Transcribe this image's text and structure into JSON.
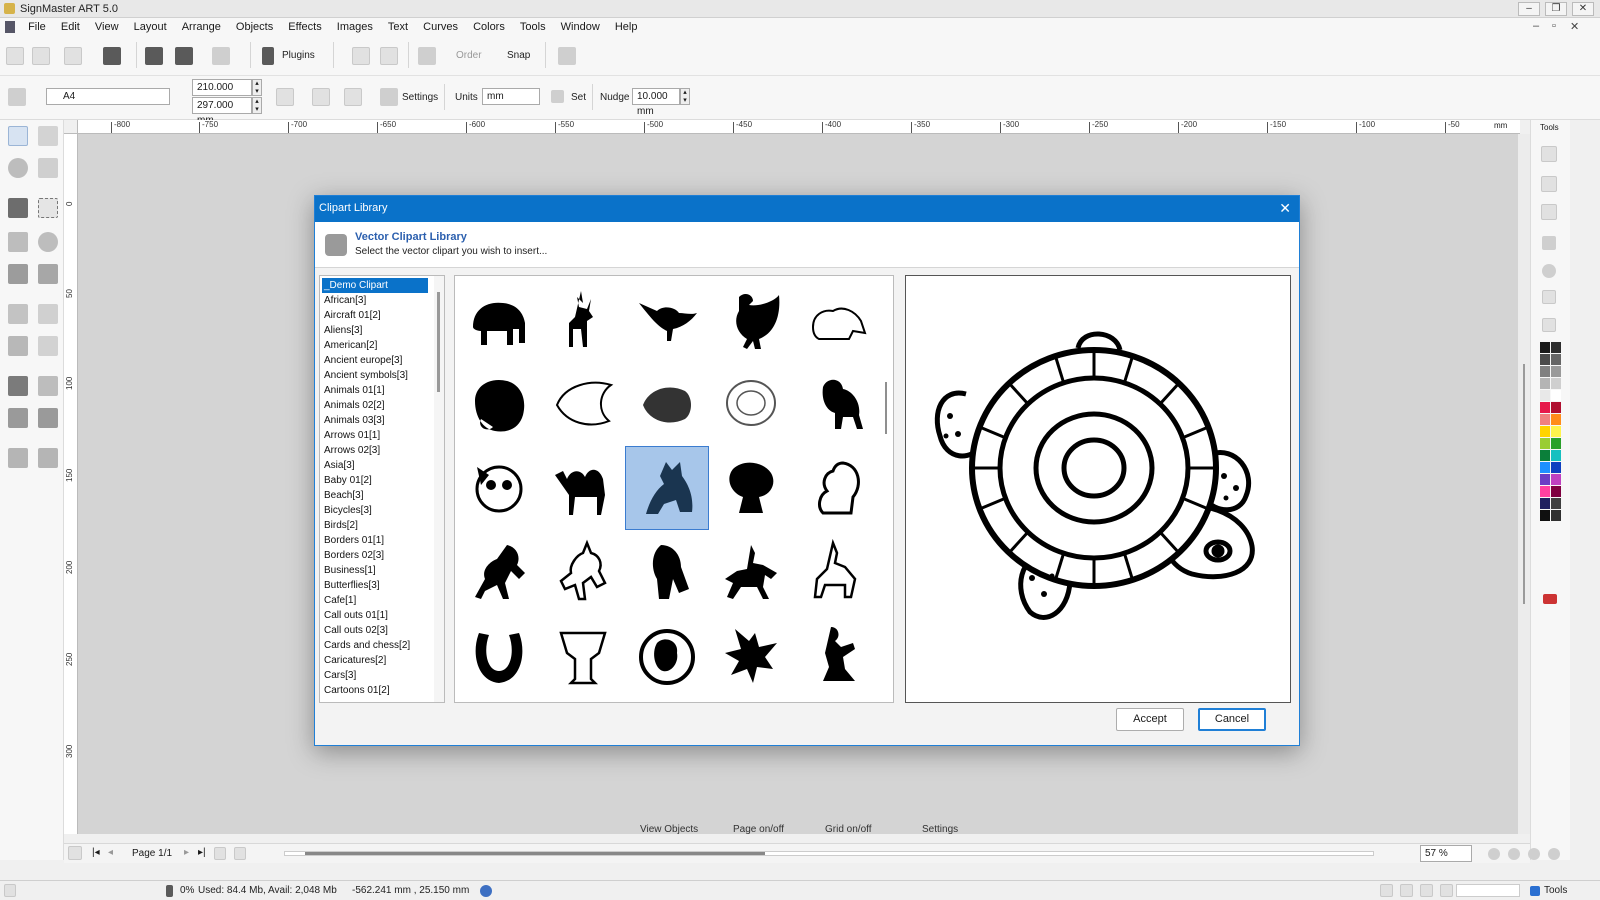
{
  "window": {
    "title": "SignMaster ART 5.0",
    "controls": [
      "–",
      "❐",
      "✕"
    ],
    "mdi_controls": [
      "–",
      "▫",
      "✕"
    ]
  },
  "menu": [
    "File",
    "Edit",
    "View",
    "Layout",
    "Arrange",
    "Objects",
    "Effects",
    "Images",
    "Text",
    "Curves",
    "Colors",
    "Tools",
    "Window",
    "Help"
  ],
  "toolbar1": {
    "plugins_label": "Plugins",
    "order_label": "Order",
    "snap_label": "Snap"
  },
  "toolbar2": {
    "page_size": "A4",
    "width_value": "210.000 mm",
    "height_value": "297.000 mm",
    "settings_label": "Settings",
    "units_label": "Units",
    "units_value": "mm",
    "set_label": "Set",
    "nudge_label": "Nudge",
    "nudge_value": "10.000 mm"
  },
  "ruler": {
    "horizontal_ticks": [
      "-800",
      "-750",
      "-700",
      "-650",
      "-600",
      "-550",
      "-500",
      "-450",
      "-400",
      "-350",
      "-300",
      "-250",
      "-200",
      "-150",
      "-100",
      "-50"
    ],
    "unit": "mm",
    "vertical_ticks": [
      "0",
      "50",
      "100",
      "150",
      "200",
      "250",
      "300"
    ]
  },
  "right_panel": {
    "tools_label": "Tools",
    "palette": [
      "#1a1a1a",
      "#2e2e2e",
      "#4a4a4a",
      "#666666",
      "#808080",
      "#9a9a9a",
      "#b4b4b4",
      "#cfcfcf",
      "#e8e8e8",
      "#ffffff",
      "#e6194b",
      "#b01030",
      "#f08080",
      "#ff8c1a",
      "#ffd400",
      "#fff34d",
      "#9acd32",
      "#2aa02a",
      "#0b7f3a",
      "#16c0c0",
      "#1e90ff",
      "#1040c0",
      "#6a3dc4",
      "#c040c0",
      "#ff40a0",
      "#7f0040",
      "#202060",
      "#404040",
      "#101010",
      "#303030"
    ]
  },
  "dialog": {
    "title": "Clipart Library",
    "heading": "Vector Clipart Library",
    "subheading": "Select the vector clipart you wish to insert...",
    "categories": [
      "_Demo Clipart",
      "African[3]",
      "Aircraft 01[2]",
      "Aliens[3]",
      "American[2]",
      "Ancient europe[3]",
      "Ancient symbols[3]",
      "Animals 01[1]",
      "Animals 02[2]",
      "Animals 03[3]",
      "Arrows 01[1]",
      "Arrows 02[3]",
      "Asia[3]",
      "Baby 01[2]",
      "Beach[3]",
      "Bicycles[3]",
      "Birds[2]",
      "Borders 01[1]",
      "Borders 02[3]",
      "Business[1]",
      "Butterflies[3]",
      "Cafe[1]",
      "Call outs 01[1]",
      "Call outs 02[3]",
      "Cards and chess[2]",
      "Caricatures[2]",
      "Cars[3]",
      "Cartoons 01[2]"
    ],
    "selected_category": "_Demo Clipart",
    "thumbnails": [
      [
        "elephant-icon",
        "deer-icon",
        "bird-icon",
        "hen-icon",
        "raccoon-sketch-icon"
      ],
      [
        "bear-icon",
        "fish-icon",
        "tropical-fish-icon",
        "turtle-icon",
        "monkey-icon"
      ],
      [
        "panda-icon",
        "camel-icon",
        "wolf-icon",
        "raccoon-icon",
        "squirrel-icon"
      ],
      [
        "rearing-horse-icon",
        "unicorn-icon",
        "horse-head-icon",
        "horse-rider-icon",
        "knight-rider-icon"
      ],
      [
        "horseshoe-icon",
        "column-capital-icon",
        "zeus-medallion-icon",
        "eagle-icon",
        "kneeling-figure-icon"
      ]
    ],
    "selected_thumbnail": "wolf-icon",
    "preview_icon": "turtle-preview-icon",
    "accept_label": "Accept",
    "cancel_label": "Cancel"
  },
  "viewbar": [
    "View Objects",
    "Page on/off",
    "Grid on/off",
    "Settings"
  ],
  "pagebar": {
    "page_label": "Page 1/1",
    "zoom": "57 %"
  },
  "status": {
    "progress": "0%",
    "memory": "Used: 84.4 Mb, Avail: 2,048 Mb",
    "coords": "-562.241 mm , 25.150 mm",
    "tools_label": "Tools"
  }
}
